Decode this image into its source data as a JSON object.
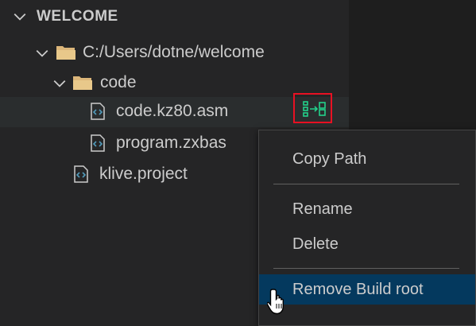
{
  "explorer": {
    "section_title": "WELCOME",
    "tree": [
      {
        "label": "C:/Users/dotne/welcome",
        "type": "folder",
        "expanded": true
      },
      {
        "label": "code",
        "type": "folder",
        "expanded": true
      },
      {
        "label": "code.kz80.asm",
        "type": "file",
        "icon": "code-file-icon"
      },
      {
        "label": "program.zxbas",
        "type": "file",
        "icon": "code-file-icon"
      },
      {
        "label": "klive.project",
        "type": "file",
        "icon": "project-file-icon"
      }
    ],
    "inline_action_icon": "build-root-icon"
  },
  "context_menu": {
    "items": [
      {
        "label": "Copy Path"
      },
      {
        "label": "Rename"
      },
      {
        "label": "Delete"
      },
      {
        "label": "Remove Build root",
        "active": true
      }
    ]
  },
  "colors": {
    "sidebar_bg": "#252526",
    "editor_bg": "#1e1e1e",
    "menu_active": "#04395e",
    "highlight_box": "#e81123",
    "folder": "#dcb67a",
    "file_icon": "#519aba",
    "build_icon": "#23d18b"
  }
}
